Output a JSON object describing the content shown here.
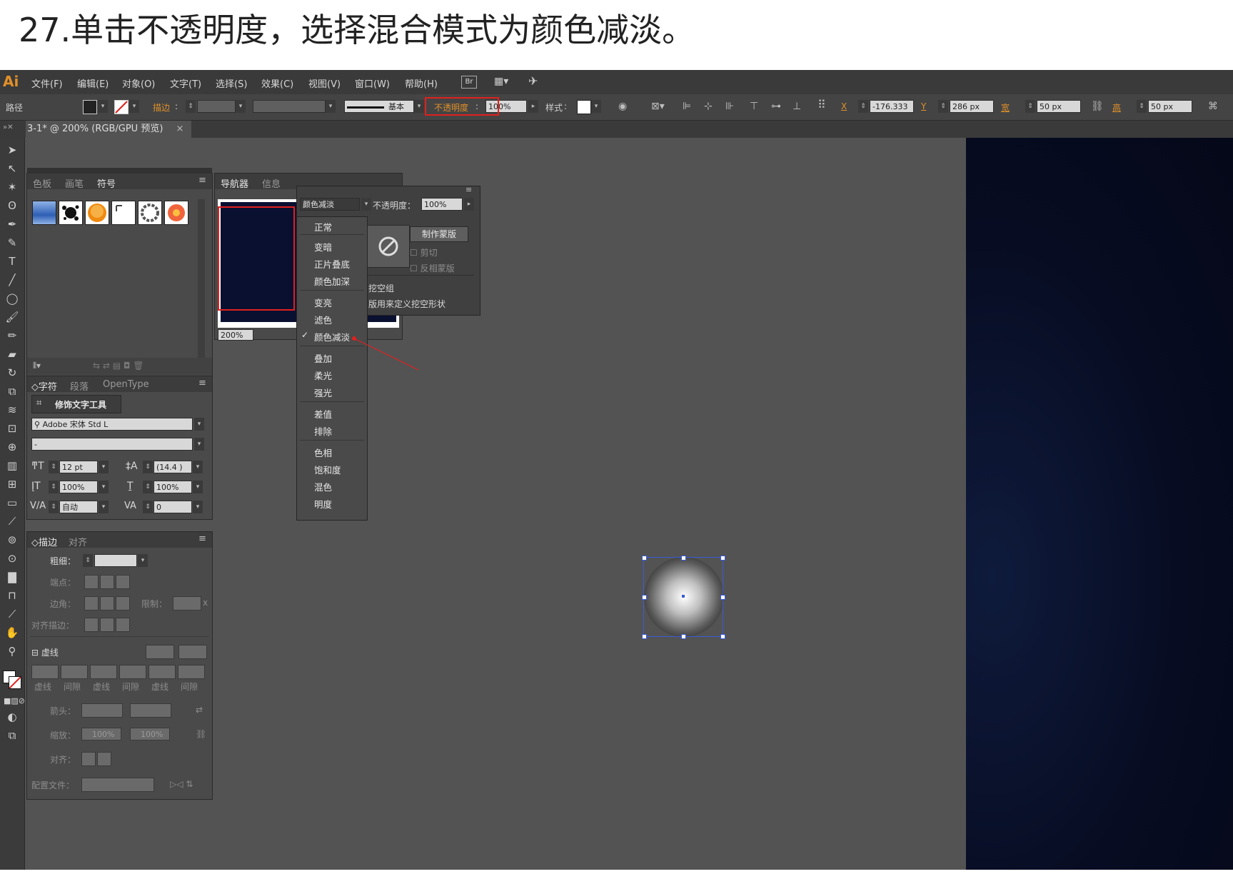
{
  "caption": "27.单击不透明度，选择混合模式为颜色减淡。",
  "app": {
    "logo": "Ai",
    "menu": [
      "文件(F)",
      "编辑(E)",
      "对象(O)",
      "文字(T)",
      "选择(S)",
      "效果(C)",
      "视图(V)",
      "窗口(W)",
      "帮助(H)"
    ],
    "br_badge": "Br"
  },
  "options_bar": {
    "path_label": "路径",
    "stroke_label": "描边",
    "brush_label": "基本",
    "opacity_label": "不透明度",
    "opacity_value": "100%",
    "style_label": "样式",
    "x_label": "X",
    "x_value": "-176.333",
    "y_label": "Y",
    "y_value": "286 px",
    "w_label": "宽",
    "w_value": "50 px",
    "h_label": "高",
    "h_value": "50 px"
  },
  "document_tab": {
    "title": "3-1* @ 200% (RGB/GPU 预览)",
    "close": "×"
  },
  "swatch_panel": {
    "tabs": [
      "色板",
      "画笔",
      "符号"
    ]
  },
  "navigator_panel": {
    "tabs": [
      "导航器",
      "信息"
    ],
    "zoom": "200%"
  },
  "character_panel": {
    "tabs": [
      "字符",
      "段落",
      "OpenType"
    ],
    "touch_type_button": "修饰文字工具",
    "font_family": "Adobe 宋体 Std L",
    "font_style": "-",
    "font_size": "12 pt",
    "leading": "(14.4 )",
    "vertical_scale": "100%",
    "horizontal_scale": "100%",
    "kerning": "自动",
    "tracking": "0"
  },
  "stroke_panel": {
    "tabs": [
      "描边",
      "对齐"
    ],
    "weight_label": "粗细",
    "cap_label": "端点",
    "corner_label": "边角",
    "limit_label": "限制",
    "limit_unit": "x",
    "align_label": "对齐描边",
    "dashed_label": "虚线",
    "dash_cols": [
      "虚线",
      "间隙",
      "虚线",
      "间隙",
      "虚线",
      "间隙"
    ],
    "arrow_label": "箭头",
    "scale_label": "缩放",
    "scale_a": "100%",
    "scale_b": "100%",
    "align2_label": "对齐",
    "profile_label": "配置文件"
  },
  "transparency_flyout": {
    "blend_mode": "颜色减淡",
    "opacity_label": "不透明度",
    "opacity_value": "100%",
    "make_mask_button": "制作蒙版",
    "clip_label": "剪切",
    "invert_label": "反相蒙版",
    "knockout_label": "挖空组",
    "knockout_shape_label": "版用来定义挖空形状"
  },
  "blend_modes": {
    "groups": [
      [
        "正常"
      ],
      [
        "变暗",
        "正片叠底",
        "颜色加深"
      ],
      [
        "变亮",
        "滤色",
        "颜色减淡"
      ],
      [
        "叠加",
        "柔光",
        "强光"
      ],
      [
        "差值",
        "排除"
      ],
      [
        "色相",
        "饱和度",
        "混色",
        "明度"
      ]
    ],
    "checked": "颜色减淡"
  },
  "colors": {
    "accent": "#e0902a",
    "highlight": "#e0201e",
    "selection": "#3a5bd6"
  }
}
